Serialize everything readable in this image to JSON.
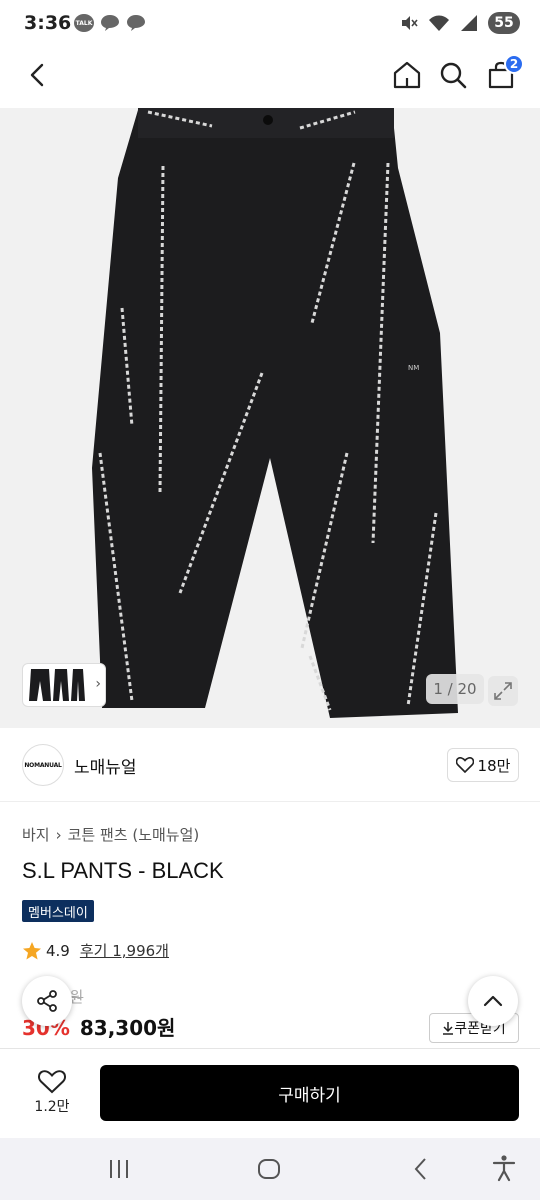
{
  "status_bar": {
    "time": "3:36",
    "talk_label": "TALK",
    "battery": "55"
  },
  "header": {
    "cart_count": "2"
  },
  "gallery": {
    "counter": "1 / 20",
    "mark": "NM"
  },
  "brand": {
    "logo_text": "NOMANUAL",
    "name": "노매뉴얼",
    "likes": "18만"
  },
  "breadcrumb": [
    "바지",
    "코튼 팬츠 (노매뉴얼)"
  ],
  "product": {
    "title": "S.L PANTS - BLACK",
    "badge": "멤버스데이",
    "rating": "4.9",
    "reviews": "후기 1,996개",
    "original_price": "9원",
    "discount": "30%",
    "sale_price": "83,300원",
    "coupon_label": "쿠폰받기"
  },
  "purchase": {
    "wish_count": "1.2만",
    "buy_label": "구매하기"
  },
  "colors": {
    "accent_blue": "#2b6cf0",
    "discount_red": "#e5322d",
    "badge_navy": "#0d2f5e"
  }
}
